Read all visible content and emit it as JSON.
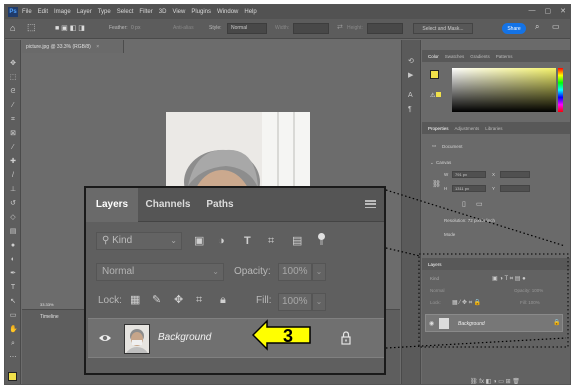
{
  "menubar": {
    "logo": "Ps",
    "items": [
      "File",
      "Edit",
      "Image",
      "Layer",
      "Type",
      "Select",
      "Filter",
      "3D",
      "View",
      "Plugins",
      "Window",
      "Help"
    ],
    "controls": [
      "—",
      "▢",
      "✕"
    ]
  },
  "options_bar": {
    "feather_label": "Feather:",
    "feather_value": "0 px",
    "anti_alias": "Anti-alias",
    "style_label": "Style:",
    "style_value": "Normal",
    "width_label": "Width:",
    "height_label": "Height:",
    "select_mask": "Select and Mask...",
    "share": "Share"
  },
  "document": {
    "tab_title": "picture.jpg @ 33.3% (RGB/8)",
    "close": "×",
    "zoom_status": "33.33%",
    "timeline_title": "Timeline"
  },
  "right_panel": {
    "color_tabs": [
      "Color",
      "Swatches",
      "Gradients",
      "Patterns"
    ],
    "properties_tabs": [
      "Properties",
      "Adjustments",
      "Libraries"
    ],
    "document_label": "Document",
    "canvas_label": "Canvas",
    "w_label": "W",
    "w_value": "791 px",
    "h_label": "H",
    "h_value": "1311 px",
    "x_label": "X",
    "y_label": "Y",
    "resolution": "Resolution: 72 pixels/inch",
    "mode_label": "Mode",
    "mini_layers_tab": "Layers",
    "mini_kind": "Kind",
    "mini_normal": "Normal",
    "mini_opacity": "Opacity: 100%",
    "mini_lock": "Lock:",
    "mini_fill": "Fill: 100%",
    "mini_layer_name": "Background"
  },
  "layers_panel": {
    "tabs": [
      "Layers",
      "Channels",
      "Paths"
    ],
    "filter_kind": "Kind",
    "blend_mode": "Normal",
    "opacity_label": "Opacity:",
    "opacity_value": "100%",
    "lock_label": "Lock:",
    "fill_label": "Fill:",
    "fill_value": "100%",
    "layer": {
      "name": "Background",
      "visible": true,
      "locked": true
    }
  },
  "callout": {
    "number": "3",
    "fill": "#ffff00",
    "stroke": "#000000"
  },
  "colors": {
    "foreground": "#f0e04a",
    "share_button": "#1473e6"
  }
}
